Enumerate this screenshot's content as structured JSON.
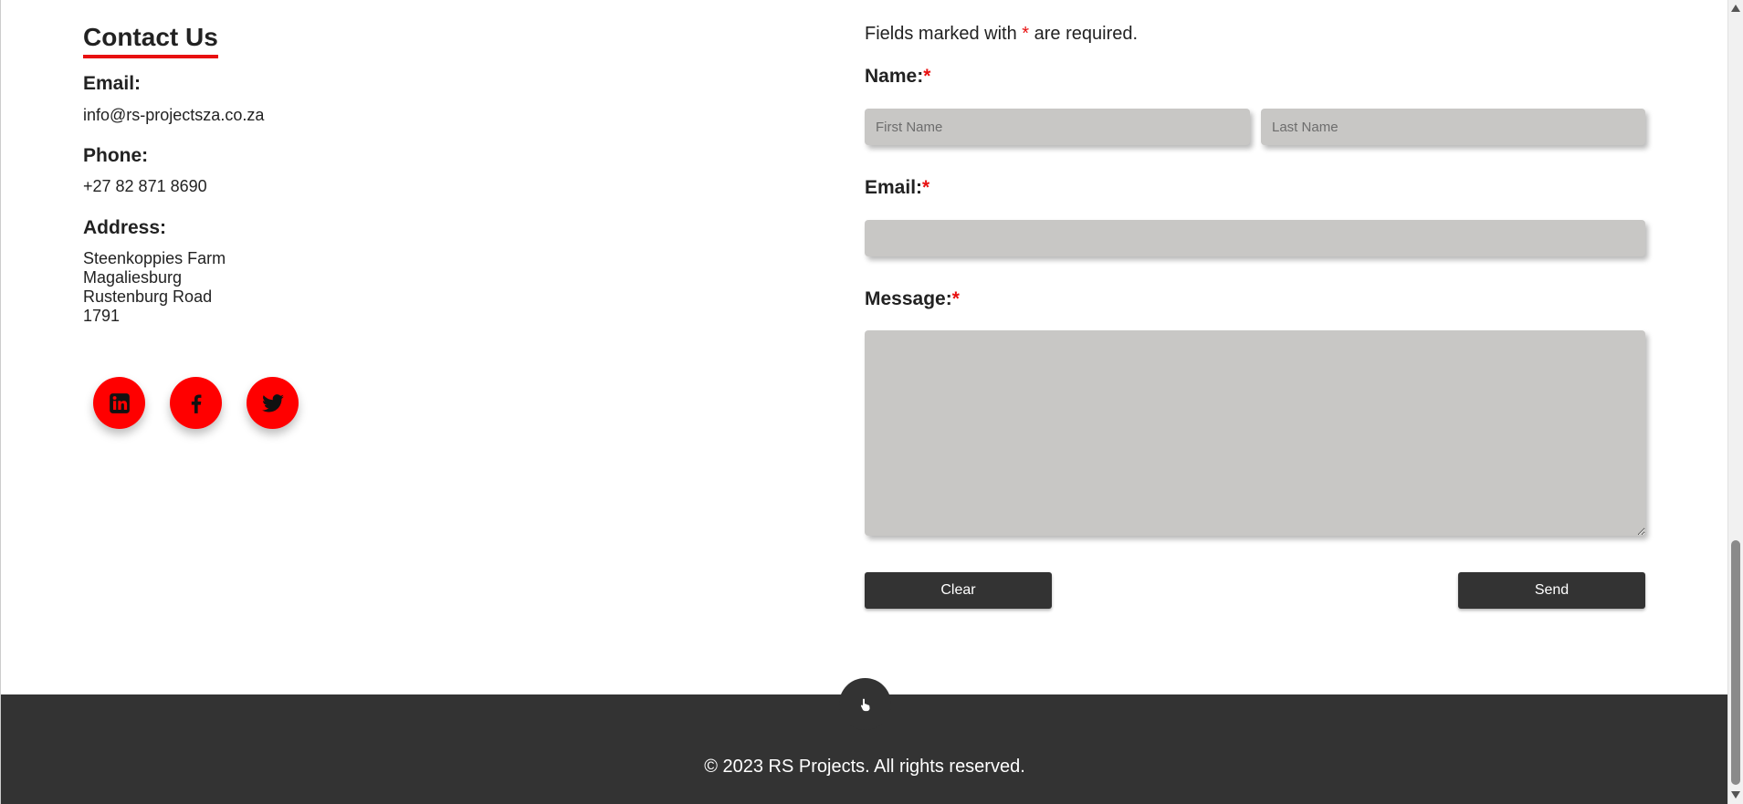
{
  "contact": {
    "title": "Contact Us",
    "email_label": "Email:",
    "email_value": "info@rs-projectsza.co.za",
    "phone_label": "Phone:",
    "phone_value": "+27 82 871 8690",
    "address_label": "Address:",
    "address_lines": [
      "Steenkoppies Farm",
      "Magaliesburg",
      "Rustenburg Road",
      "1791"
    ]
  },
  "social": [
    {
      "icon": "linkedin-icon"
    },
    {
      "icon": "facebook-icon"
    },
    {
      "icon": "twitter-icon"
    }
  ],
  "form": {
    "required_note_before": "Fields marked with ",
    "required_star": "*",
    "required_note_after": " are required.",
    "name_label": "Name:",
    "first_name_placeholder": "First Name",
    "last_name_placeholder": "Last Name",
    "email_label": "Email:",
    "message_label": "Message:",
    "clear_label": "Clear",
    "send_label": "Send"
  },
  "footer": {
    "copyright": "© 2023 RS Projects. All rights reserved.",
    "scroll_top_icon": "pointer-hand-icon"
  },
  "colors": {
    "accent": "#ff0000",
    "dark": "#333333",
    "field_bg": "#c8c7c5"
  }
}
